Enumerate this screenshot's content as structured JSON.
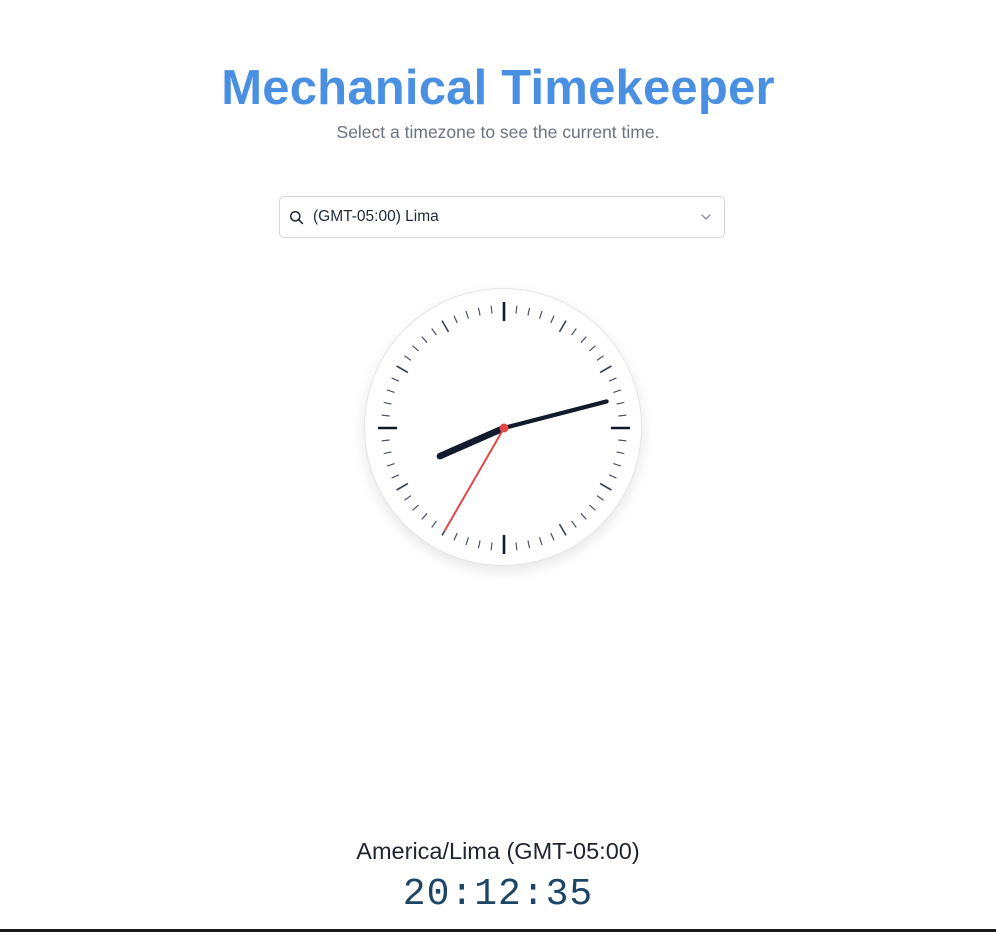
{
  "header": {
    "title": "Mechanical Timekeeper",
    "subtitle": "Select a timezone to see the current time."
  },
  "timezone_select": {
    "value": "(GMT-05:00) Lima",
    "search_icon": "search-icon",
    "chevron_icon": "chevron-down-icon"
  },
  "clock": {
    "time": {
      "hours": 20,
      "minutes": 12,
      "seconds": 35
    },
    "face_color": "#ffffff",
    "hand_color": "#111b2b",
    "second_hand_color": "#e04848",
    "center_dot_color": "#e04848"
  },
  "footer": {
    "timezone_label": "America/Lima (GMT-05:00)",
    "digital_time": "20:12:35"
  },
  "colors": {
    "title": "#4a90e2",
    "subtitle": "#6b7280",
    "digital_time": "#1c4566"
  }
}
